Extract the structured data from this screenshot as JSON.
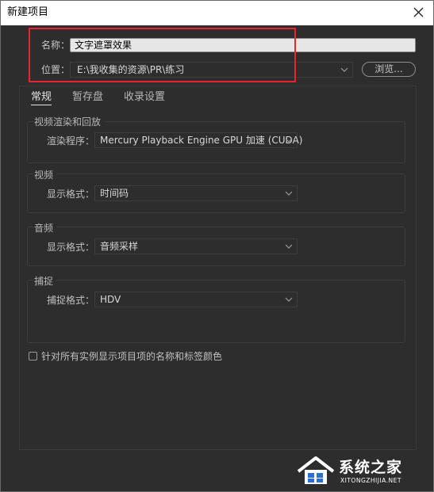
{
  "window": {
    "title": "新建项目"
  },
  "form": {
    "name_label": "名称：",
    "name_value": "文字遮罩效果",
    "location_label": "位置：",
    "location_value": "E:\\我收集的资源\\PR\\练习",
    "browse_label": "浏览..."
  },
  "tabs": [
    {
      "label": "常规",
      "active": true
    },
    {
      "label": "暂存盘",
      "active": false
    },
    {
      "label": "收录设置",
      "active": false
    }
  ],
  "sections": {
    "video_render": {
      "title": "视频渲染和回放",
      "row_label": "渲染程序：",
      "value": "Mercury Playback Engine GPU 加速 (CUDA)"
    },
    "video": {
      "title": "视频",
      "row_label": "显示格式：",
      "value": "时间码"
    },
    "audio": {
      "title": "音频",
      "row_label": "显示格式：",
      "value": "音频采样"
    },
    "capture": {
      "title": "捕捉",
      "row_label": "捕捉格式：",
      "value": "HDV"
    }
  },
  "checkbox": {
    "label": "针对所有实例显示项目项的名称和标签颜色",
    "checked": false
  },
  "watermark": {
    "brand": "系统之家",
    "url": "XITONGZHIJIA.NET"
  },
  "colors": {
    "background": "#2d2d2d",
    "highlight": "#e8242e",
    "text": "#c8c8c8"
  }
}
